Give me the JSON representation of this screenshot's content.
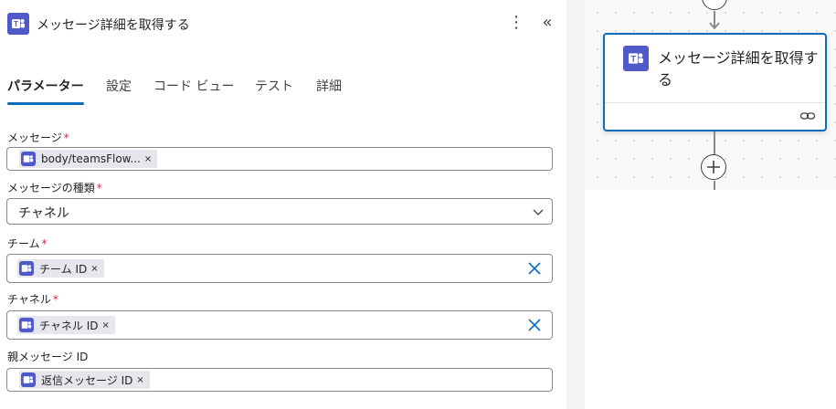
{
  "header": {
    "title": "メッセージ詳細を取得する",
    "more_glyph": "⋮",
    "collapse_glyph": "«"
  },
  "tabs": [
    {
      "label": "パラメーター"
    },
    {
      "label": "設定"
    },
    {
      "label": "コード ビュー"
    },
    {
      "label": "テスト"
    },
    {
      "label": "詳細"
    }
  ],
  "fields": {
    "message": {
      "label": "メッセージ",
      "required": "*",
      "token": "body/teamsFlow...",
      "token_remove": "×"
    },
    "message_type": {
      "label": "メッセージの種類",
      "required": "*",
      "value": "チャネル"
    },
    "team": {
      "label": "チーム",
      "required": "*",
      "token": "チーム ID",
      "token_remove": "×"
    },
    "channel": {
      "label": "チャネル",
      "required": "*",
      "token": "チャネル ID",
      "token_remove": "×"
    },
    "parent_message": {
      "label": "親メッセージ ID",
      "token": "返信メッセージ ID",
      "token_remove": "×"
    }
  },
  "card": {
    "title": "メッセージ詳細を取得する"
  },
  "icons": {
    "app": "teams-icon",
    "link": "link-icon",
    "add": "plus-icon"
  },
  "colors": {
    "accent": "#0f6cbd",
    "teams": "#5059c9",
    "required": "#c4314b"
  }
}
